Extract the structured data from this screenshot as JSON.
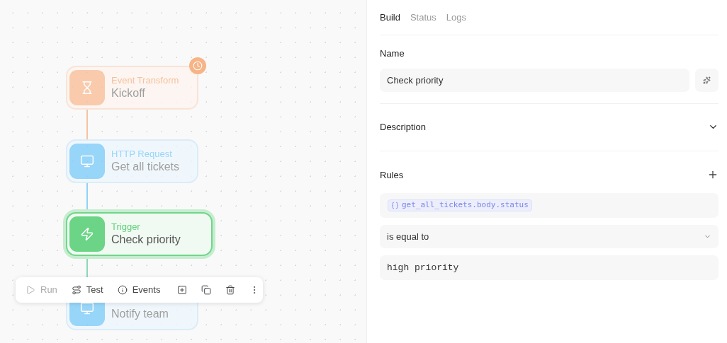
{
  "canvas": {
    "nodes": [
      {
        "kind": "transform",
        "kind_label": "Event Transform",
        "title": "Kickoff",
        "selected": false,
        "scheduled": true
      },
      {
        "kind": "http",
        "kind_label": "HTTP Request",
        "title": "Get all tickets",
        "selected": false,
        "scheduled": false
      },
      {
        "kind": "trigger",
        "kind_label": "Trigger",
        "title": "Check priority",
        "selected": true,
        "scheduled": false
      },
      {
        "kind": "http",
        "title": "Notify team",
        "selected": false,
        "scheduled": false
      }
    ],
    "toolbar": [
      {
        "kind": "run",
        "label": "Run",
        "disabled": true
      },
      {
        "kind": "test",
        "label": "Test",
        "disabled": false
      },
      {
        "kind": "events",
        "label": "Events",
        "disabled": false
      },
      {
        "kind": "add",
        "disabled": false
      },
      {
        "kind": "duplicate",
        "disabled": false
      },
      {
        "kind": "delete",
        "disabled": false
      },
      {
        "kind": "more",
        "disabled": false
      }
    ]
  },
  "panel": {
    "tabs": [
      {
        "label": "Build",
        "selected": true
      },
      {
        "label": "Status",
        "selected": false
      },
      {
        "label": "Logs",
        "selected": false
      }
    ],
    "name": {
      "label": "Name",
      "value": "Check priority"
    },
    "description": {
      "label": "Description",
      "expanded": false
    },
    "rules": {
      "label": "Rules",
      "variable": "get_all_tickets.body.status",
      "operator": "is equal to",
      "value": "high priority"
    }
  }
}
